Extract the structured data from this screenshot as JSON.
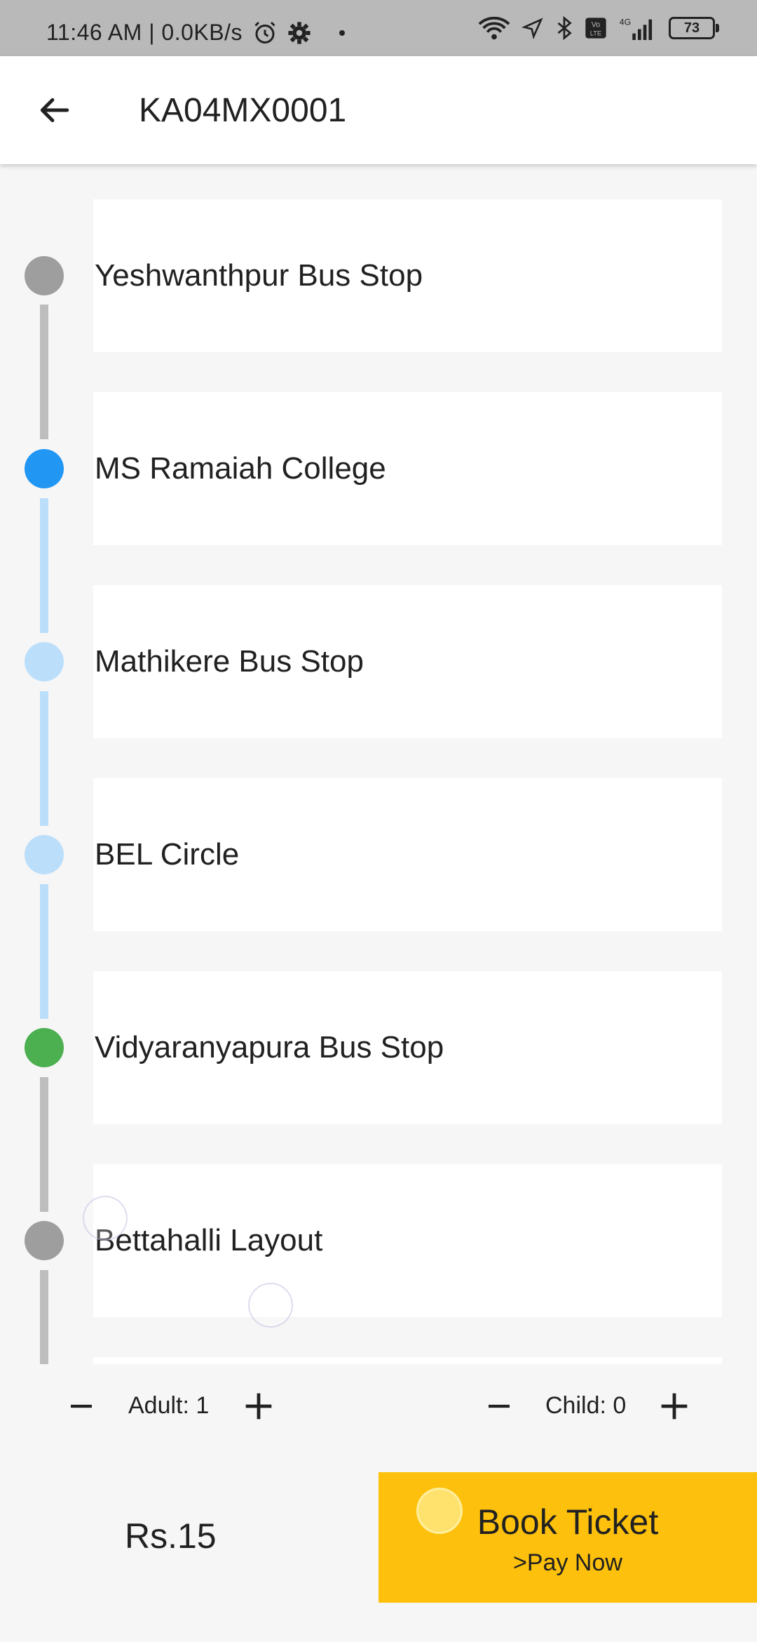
{
  "status_bar": {
    "time_info": "11:46 AM | 0.0KB/s",
    "battery": "73"
  },
  "app_bar": {
    "title": "KA04MX0001"
  },
  "colors": {
    "passed": "#9e9e9e",
    "current": "#2196f3",
    "upcoming": "#bbdefb",
    "destination": "#4caf50",
    "book_button": "#fdc00c"
  },
  "stops": [
    {
      "label": "Yeshwanthpur Bus Stop",
      "state": "passed"
    },
    {
      "label": "MS Ramaiah College",
      "state": "current"
    },
    {
      "label": "Mathikere Bus Stop",
      "state": "upcoming"
    },
    {
      "label": "BEL Circle",
      "state": "upcoming"
    },
    {
      "label": "Vidyaranyapura Bus Stop",
      "state": "destination"
    },
    {
      "label": "Bettahalli Layout",
      "state": "passed"
    }
  ],
  "counters": {
    "adult_label": "Adult: 1",
    "child_label": "Child: 0"
  },
  "footer": {
    "price": "Rs.15",
    "book_label": "Book Ticket",
    "book_sub": ">Pay Now"
  }
}
